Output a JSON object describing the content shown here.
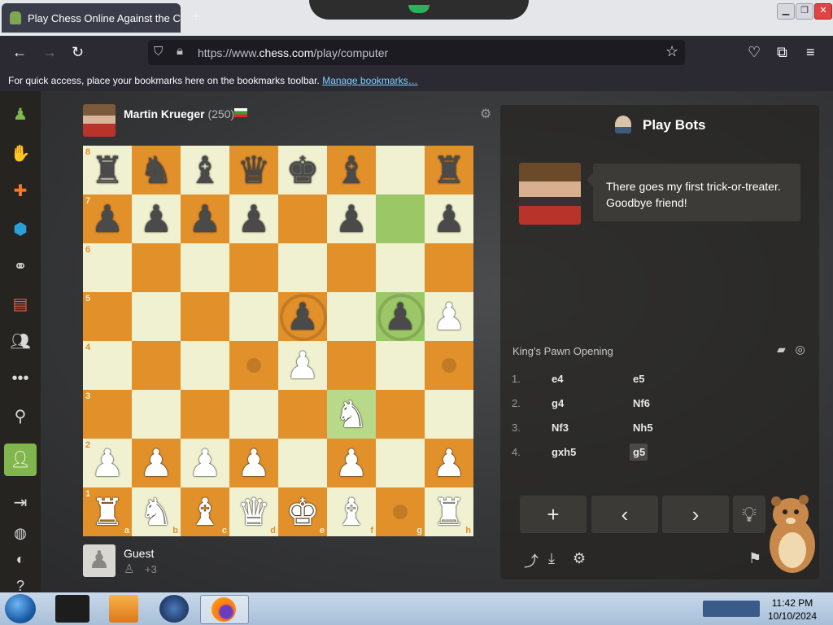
{
  "browser": {
    "tab_title": "Play Chess Online Against the C",
    "url_prefix": "https://www.",
    "url_domain": "chess.com",
    "url_path": "/play/computer",
    "bookmarks_text": "For quick access, place your bookmarks here on the bookmarks toolbar.",
    "bookmarks_link": "Manage bookmarks…"
  },
  "opponent": {
    "name": "Martin Krueger",
    "rating": "(250)"
  },
  "player": {
    "name": "Guest",
    "material": "+3"
  },
  "board": {
    "ranks": [
      "8",
      "7",
      "6",
      "5",
      "4",
      "3",
      "2",
      "1"
    ],
    "files": [
      "a",
      "b",
      "c",
      "d",
      "e",
      "f",
      "g",
      "h"
    ],
    "pieces": [
      [
        "br",
        "bn",
        "bb",
        "bq",
        "bk",
        "bb",
        "",
        "br"
      ],
      [
        "bp",
        "bp",
        "bp",
        "bp",
        "",
        "bp",
        "",
        "bp"
      ],
      [
        "",
        "",
        "",
        "",
        "",
        "",
        "",
        ""
      ],
      [
        "",
        "",
        "",
        "",
        "bp",
        "",
        "bp",
        "wp"
      ],
      [
        "",
        "",
        "",
        "",
        "wp",
        "",
        "",
        ""
      ],
      [
        "",
        "",
        "",
        "",
        "",
        "wn",
        "",
        ""
      ],
      [
        "wp",
        "wp",
        "wp",
        "wp",
        "",
        "wp",
        "",
        "wp"
      ],
      [
        "wr",
        "wn",
        "wb",
        "wq",
        "wk",
        "wb",
        "",
        "wr"
      ]
    ],
    "highlights": [
      "g7",
      "g5",
      "f3"
    ],
    "move_dots": [
      "d4",
      "h4",
      "g1"
    ],
    "capture_rings": [
      "e5",
      "g5"
    ]
  },
  "panel": {
    "title": "Play Bots",
    "bot_message": "There goes my first trick-or-treater. Goodbye friend!",
    "opening": "King's Pawn Opening",
    "moves": [
      {
        "num": "1.",
        "white": "e4",
        "black": "e5"
      },
      {
        "num": "2.",
        "white": "g4",
        "black": "Nf6"
      },
      {
        "num": "3.",
        "white": "Nf3",
        "black": "Nh5"
      },
      {
        "num": "4.",
        "white": "gxh5",
        "black": "g5"
      }
    ]
  },
  "taskbar": {
    "time": "11:42 PM",
    "date": "10/10/2024"
  }
}
